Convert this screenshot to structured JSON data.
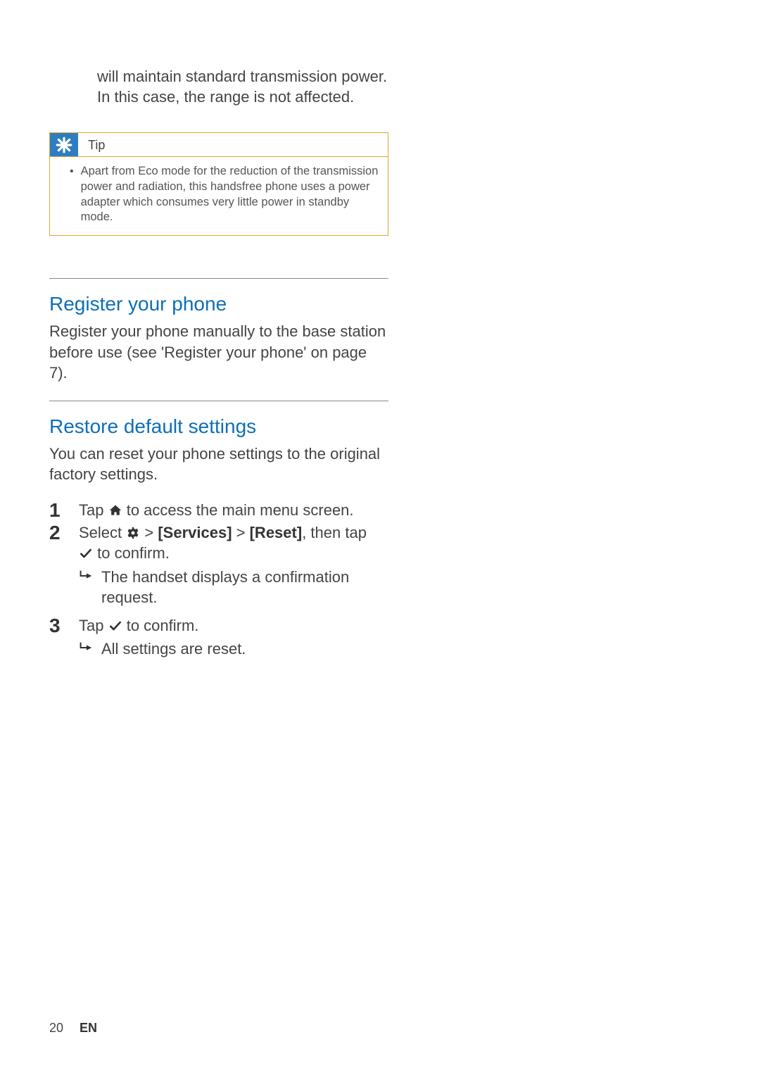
{
  "carryover": "will maintain standard transmission power. In this case, the range is not affected.",
  "tip": {
    "label": "Tip",
    "body": "Apart from Eco mode for the reduction of the transmission power and radiation, this handsfree phone uses a power adapter which consumes very little power in standby mode."
  },
  "section1": {
    "heading": "Register your phone",
    "body": "Register your phone manually to the base station before use (see 'Register your phone' on page 7)."
  },
  "section2": {
    "heading": "Restore default settings",
    "intro": "You can reset your phone settings to the original factory settings.",
    "steps": {
      "s1": {
        "num": "1",
        "pre": "Tap ",
        "post": " to access the main menu screen."
      },
      "s2": {
        "num": "2",
        "pre": "Select ",
        "mid1": " > ",
        "label1": "[Services]",
        "mid2": " > ",
        "label2": "[Reset]",
        "post": ", then tap ",
        "end": " to confirm.",
        "sub": "The handset displays a confirmation request."
      },
      "s3": {
        "num": "3",
        "pre": "Tap ",
        "post": " to confirm.",
        "sub": "All settings are reset."
      }
    }
  },
  "footer": {
    "page": "20",
    "lang": "EN"
  }
}
